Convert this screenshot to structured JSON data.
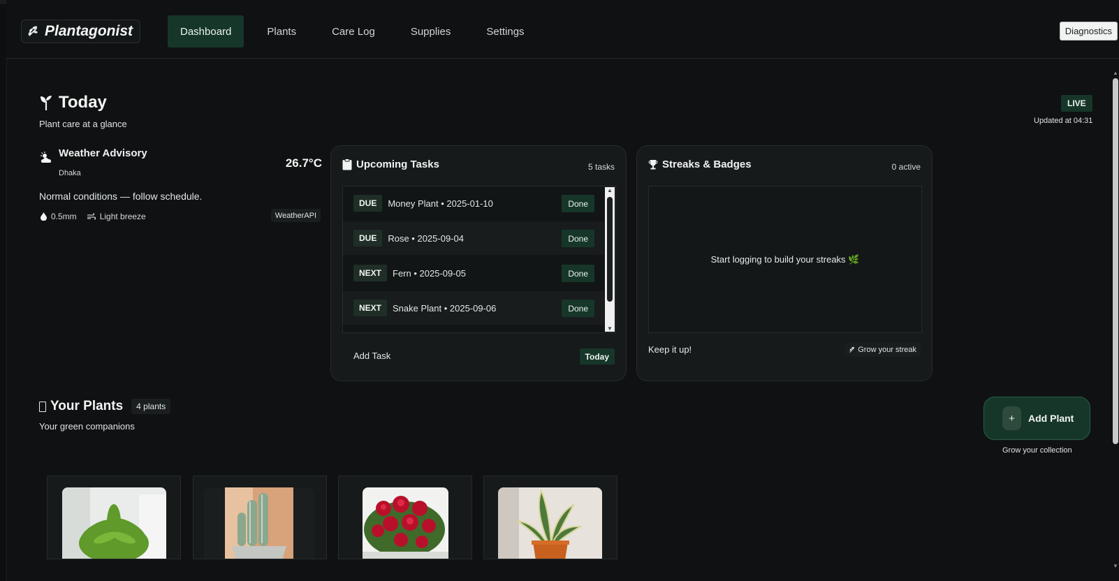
{
  "app": {
    "brand": "Plantagonist",
    "diagnostics_label": "Diagnostics"
  },
  "nav": {
    "tabs": [
      {
        "label": "Dashboard",
        "active": true
      },
      {
        "label": "Plants",
        "active": false
      },
      {
        "label": "Care Log",
        "active": false
      },
      {
        "label": "Supplies",
        "active": false
      },
      {
        "label": "Settings",
        "active": false
      }
    ]
  },
  "today": {
    "title": "Today",
    "subtitle": "Plant care at a glance",
    "live_label": "LIVE",
    "updated": "Updated at 04:31"
  },
  "weather": {
    "title": "Weather Advisory",
    "city": "Dhaka",
    "temperature": "26.7°C",
    "message": "Normal conditions — follow schedule.",
    "rain": "0.5mm",
    "wind": "Light breeze",
    "source": "WeatherAPI"
  },
  "tasks": {
    "title": "Upcoming Tasks",
    "count": "5 tasks",
    "items": [
      {
        "tag": "DUE",
        "text": "Money Plant • 2025-01-10",
        "action": "Done"
      },
      {
        "tag": "DUE",
        "text": "Rose • 2025-09-04",
        "action": "Done"
      },
      {
        "tag": "NEXT",
        "text": "Fern • 2025-09-05",
        "action": "Done"
      },
      {
        "tag": "NEXT",
        "text": "Snake Plant • 2025-09-06",
        "action": "Done"
      }
    ],
    "add_label": "Add Task",
    "today_chip": "Today"
  },
  "streaks": {
    "title": "Streaks & Badges",
    "count": "0 active",
    "empty_message": "Start logging to build your streaks 🌿",
    "footer_text": "Keep it up!",
    "chip": "Grow your streak"
  },
  "plants": {
    "title": "Your Plants",
    "count": "4 plants",
    "subtitle": "Your green companions",
    "add_label": "Add Plant",
    "add_plus": "+",
    "add_caption": "Grow your collection"
  },
  "icons": {
    "brand": "leaf-sprig-icon",
    "today": "sprout-icon",
    "weather": "cloud-sun-icon",
    "rain": "droplet-icon",
    "wind": "wind-icon",
    "tasks": "clipboard-icon",
    "streaks": "trophy-icon",
    "plants": "phone-icon"
  },
  "colors": {
    "accent": "#17362a",
    "background": "#0f1112",
    "card": "#161a1b"
  }
}
